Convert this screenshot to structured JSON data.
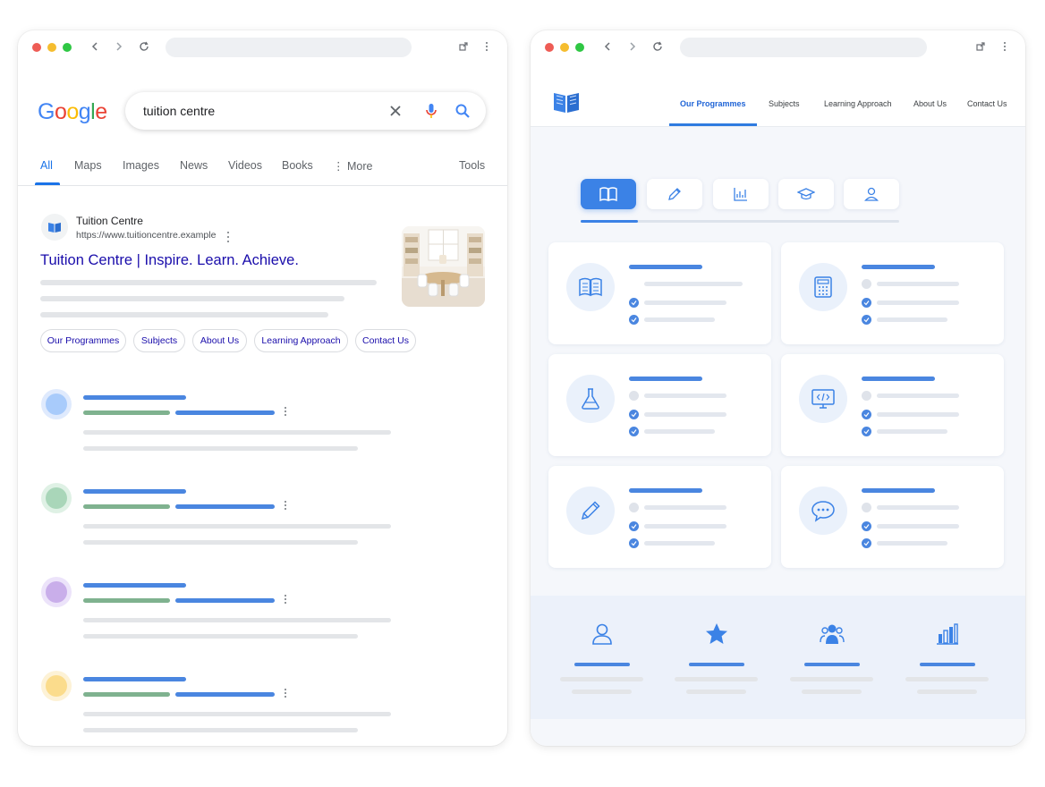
{
  "left_window": {
    "search": {
      "query": "tuition centre"
    },
    "logo": {
      "letters": [
        "G",
        "o",
        "o",
        "g",
        "l",
        "e"
      ],
      "colors": [
        "#4285f4",
        "#ea4335",
        "#fbbc05",
        "#4285f4",
        "#34a853",
        "#ea4335"
      ]
    },
    "tabs": [
      {
        "label": "All",
        "active": true
      },
      {
        "label": "Maps"
      },
      {
        "label": "Images"
      },
      {
        "label": "News"
      },
      {
        "label": "Videos"
      },
      {
        "label": "Books"
      },
      {
        "label": "More"
      }
    ],
    "tools_label": "Tools",
    "result": {
      "site_name": "Tuition Centre",
      "url": "https://www.tuitioncentre.example",
      "title": "Tuition Centre | Inspire. Learn. Achieve.",
      "sitelinks": [
        "Our Programmes",
        "Subjects",
        "About Us",
        "Learning Approach",
        "Contact Us"
      ]
    },
    "placeholder_result_colors": [
      "#a8cbfb",
      "#a9d6b9",
      "#c9aeea",
      "#fbdc8c"
    ]
  },
  "right_window": {
    "nav": [
      {
        "label": "Our Programmes",
        "active": true
      },
      {
        "label": "Subjects"
      },
      {
        "label": "Learning Approach"
      },
      {
        "label": "About Us"
      },
      {
        "label": "Contact Us"
      }
    ],
    "icon_tabs": [
      "book-icon",
      "pencil-icon",
      "chart-icon",
      "graduation-cap-icon",
      "user-icon"
    ],
    "cards": [
      "open-book-icon",
      "calculator-icon",
      "flask-icon",
      "code-monitor-icon",
      "pencil-icon",
      "chat-bubble-icon"
    ],
    "stats_icons": [
      "user-icon",
      "star-icon",
      "group-icon",
      "bar-chart-icon"
    ],
    "accent_color": "#3b82e6"
  }
}
